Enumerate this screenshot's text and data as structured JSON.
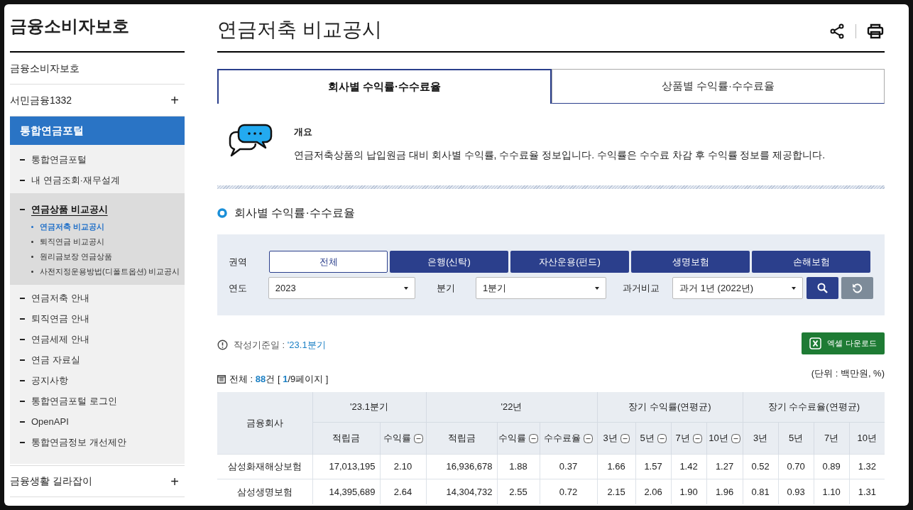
{
  "sidebar": {
    "title": "금융소비자보호",
    "items": [
      {
        "label": "금융소비자보호",
        "selected": false
      },
      {
        "label": "서민금융1332",
        "toggle": "+",
        "selected": false
      },
      {
        "label": "통합연금포털",
        "selected": true,
        "children": [
          {
            "label": "통합연금포털",
            "selected": false
          },
          {
            "label": "내 연금조회·재무설계",
            "selected": false
          },
          {
            "label": "연금상품 비교공시",
            "selected": true,
            "children": [
              {
                "label": "연금저축 비교공시",
                "selected": true
              },
              {
                "label": "퇴직연금 비교공시",
                "selected": false
              },
              {
                "label": "원리금보장 연금상품",
                "selected": false
              },
              {
                "label": "사전지정운용방법(디폴트옵션) 비교공시",
                "selected": false
              }
            ]
          },
          {
            "label": "연금저축 안내",
            "selected": false
          },
          {
            "label": "퇴직연금 안내",
            "selected": false
          },
          {
            "label": "연금세제 안내",
            "selected": false
          },
          {
            "label": "연금 자료실",
            "selected": false
          },
          {
            "label": "공지사항",
            "selected": false
          },
          {
            "label": "통합연금포털 로그인",
            "selected": false
          },
          {
            "label": "OpenAPI",
            "selected": false
          },
          {
            "label": "통합연금정보 개선제안",
            "selected": false
          }
        ]
      },
      {
        "label": "금융생활 길라잡이",
        "toggle": "+",
        "selected": false
      }
    ]
  },
  "page_title": "연금저축 비교공시",
  "tabs": [
    {
      "label": "회사별 수익률·수수료율",
      "selected": true
    },
    {
      "label": "상품별 수익률·수수료율",
      "selected": false
    }
  ],
  "overview": {
    "title": "개요",
    "text": "연금저축상품의 납입원금 대비 회사별 수익률, 수수료율 정보입니다. 수익률은 수수료 차감 후 수익률 정보를 제공합니다."
  },
  "section_title": "회사별 수익률·수수료율",
  "filters": {
    "region_label": "권역",
    "regions": [
      {
        "label": "전체",
        "selected": true
      },
      {
        "label": "은행(신탁)",
        "selected": false
      },
      {
        "label": "자산운용(펀드)",
        "selected": false
      },
      {
        "label": "생명보험",
        "selected": false
      },
      {
        "label": "손해보험",
        "selected": false
      }
    ],
    "selects": [
      {
        "label": "연도",
        "value": "2023"
      },
      {
        "label": "분기",
        "value": "1분기"
      },
      {
        "label": "과거비교",
        "value": "과거 1년 (2022년)"
      }
    ]
  },
  "basis": {
    "label": "작성기준일 : ",
    "value": "'23.1분기"
  },
  "excel_button": "엑셀 다운로드",
  "count": {
    "prefix": "전체 : ",
    "total": "88",
    "middle": "건 [ ",
    "page": "1",
    "suffix": "/9페이지 ]"
  },
  "unit_note": "(단위 : 백만원, %)",
  "table": {
    "company_header": "금융회사",
    "groups": [
      {
        "label": "'23.1분기",
        "columns": [
          {
            "label": "적립금",
            "sortable": false
          },
          {
            "label": "수익률",
            "sortable": true
          }
        ]
      },
      {
        "label": "'22년",
        "columns": [
          {
            "label": "적립금",
            "sortable": false
          },
          {
            "label": "수익률",
            "sortable": true
          },
          {
            "label": "수수료율",
            "sortable": true
          }
        ]
      },
      {
        "label": "장기 수익률(연평균)",
        "columns": [
          {
            "label": "3년",
            "sortable": true
          },
          {
            "label": "5년",
            "sortable": true
          },
          {
            "label": "7년",
            "sortable": true
          },
          {
            "label": "10년",
            "sortable": true
          }
        ]
      },
      {
        "label": "장기 수수료율(연평균)",
        "columns": [
          {
            "label": "3년",
            "sortable": false
          },
          {
            "label": "5년",
            "sortable": false
          },
          {
            "label": "7년",
            "sortable": false
          },
          {
            "label": "10년",
            "sortable": false
          }
        ]
      }
    ],
    "rows": [
      [
        "삼성화재해상보험",
        "17,013,195",
        "2.10",
        "16,936,678",
        "1.88",
        "0.37",
        "1.66",
        "1.57",
        "1.42",
        "1.27",
        "0.52",
        "0.70",
        "0.89",
        "1.32"
      ],
      [
        "삼성생명보험",
        "14,395,689",
        "2.64",
        "14,304,732",
        "2.55",
        "0.72",
        "2.15",
        "2.06",
        "1.90",
        "1.96",
        "0.81",
        "0.93",
        "1.10",
        "1.31"
      ]
    ]
  }
}
